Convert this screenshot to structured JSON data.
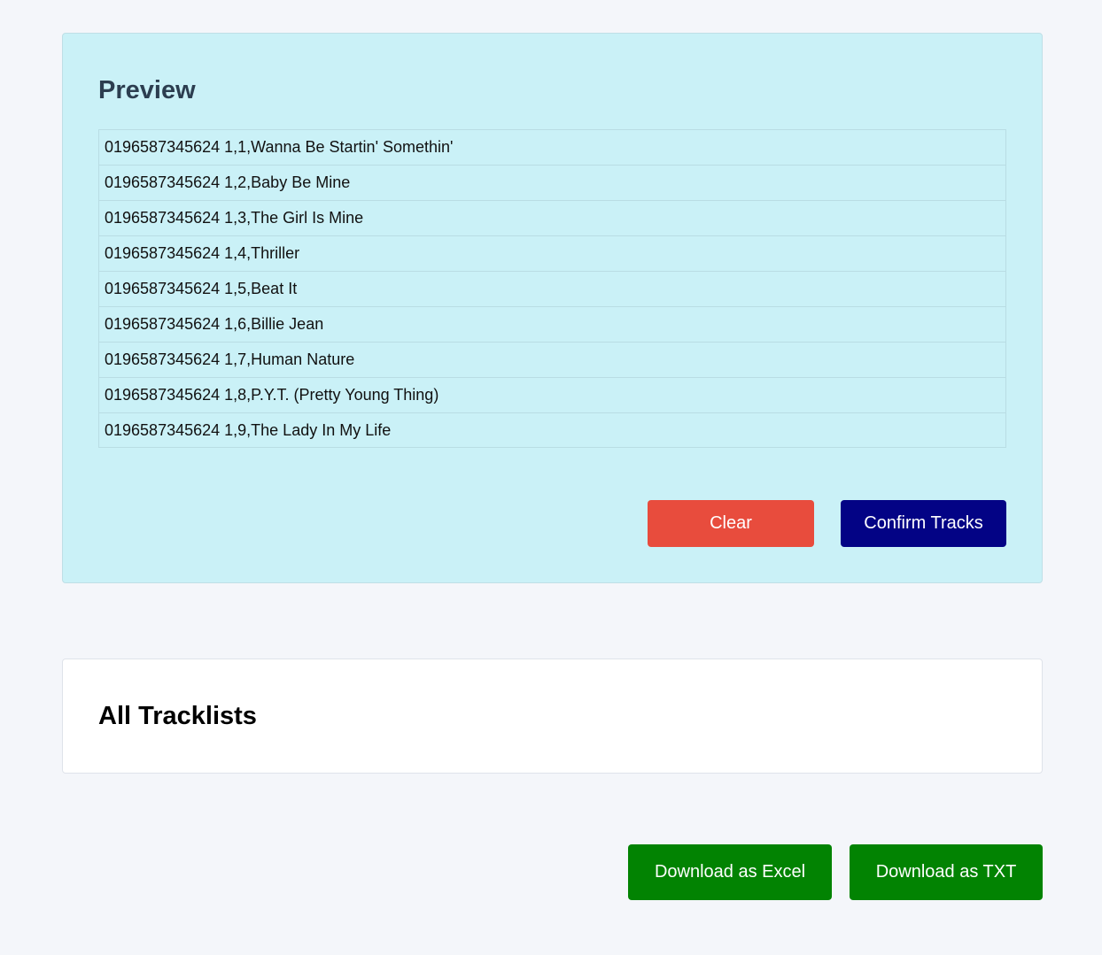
{
  "preview": {
    "title": "Preview",
    "tracks": [
      "0196587345624 1,1,Wanna Be Startin' Somethin'",
      "0196587345624 1,2,Baby Be Mine",
      "0196587345624 1,3,The Girl Is Mine",
      "0196587345624 1,4,Thriller",
      "0196587345624 1,5,Beat It",
      "0196587345624 1,6,Billie Jean",
      "0196587345624 1,7,Human Nature",
      "0196587345624 1,8,P.Y.T. (Pretty Young Thing)",
      "0196587345624 1,9,The Lady In My Life"
    ],
    "clear_label": "Clear",
    "confirm_label": "Confirm Tracks"
  },
  "tracklists": {
    "title": "All Tracklists"
  },
  "downloads": {
    "excel_label": "Download as Excel",
    "txt_label": "Download as TXT"
  },
  "colors": {
    "preview_bg": "#caf1f7",
    "clear": "#e84c3d",
    "confirm": "#030385",
    "download": "#028302",
    "page_bg": "#f4f6fa"
  }
}
